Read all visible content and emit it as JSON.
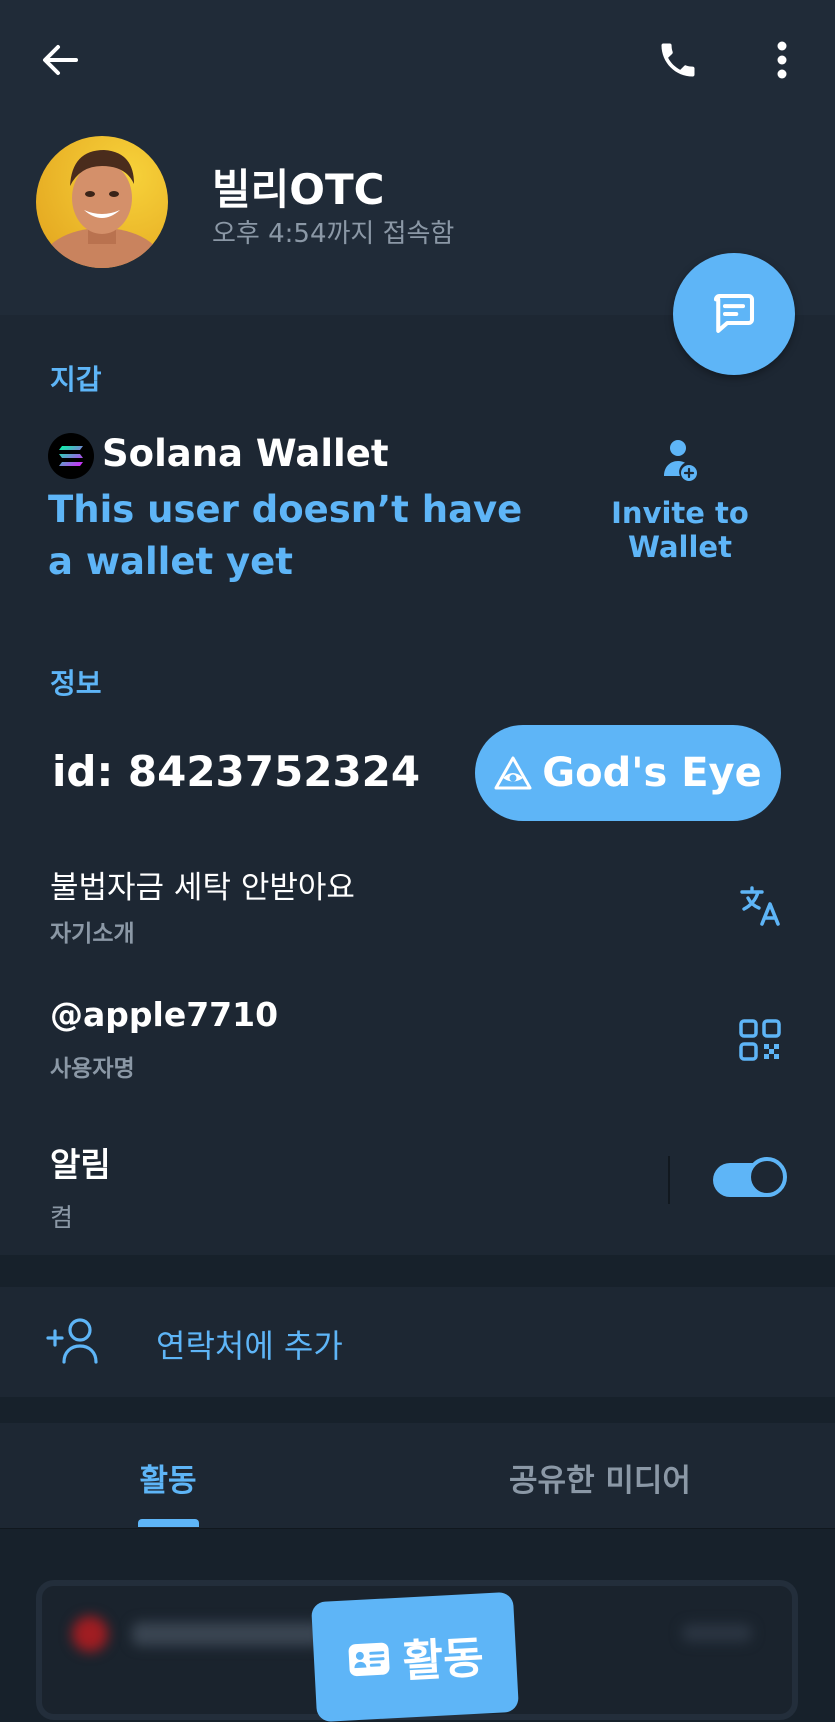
{
  "header": {
    "name": "빌리OTC",
    "status": "오후 4:54까지 접속함",
    "icons": {
      "back": "back-arrow-icon",
      "call": "phone-icon",
      "menu": "more-vertical-icon",
      "message": "message-icon"
    }
  },
  "wallet": {
    "section_title": "지갑",
    "wallet_name": "Solana Wallet",
    "no_wallet_line1": "This user doesn’t have",
    "no_wallet_line2": "a wallet yet",
    "invite_label": "Invite to Wallet"
  },
  "info": {
    "section_title": "정보",
    "id_text": "id: 8423752324",
    "gods_eye_label": "God's Eye",
    "bio_value": "불법자금 세탁 안받아요",
    "bio_label": "자기소개",
    "username_value": "@apple7710",
    "username_label": "사용자명",
    "notifications_value": "알림",
    "notifications_state": "켬"
  },
  "actions": {
    "add_contact": "연락처에 추가"
  },
  "tabs": [
    {
      "label": "활동",
      "active": true
    },
    {
      "label": "공유한 미디어",
      "active": false
    }
  ],
  "activity": {
    "badge_label": "활동"
  },
  "colors": {
    "accent": "#5eb5f7",
    "header_bg": "#202b38",
    "section_bg": "#1d2733",
    "page_bg": "#17212b"
  }
}
